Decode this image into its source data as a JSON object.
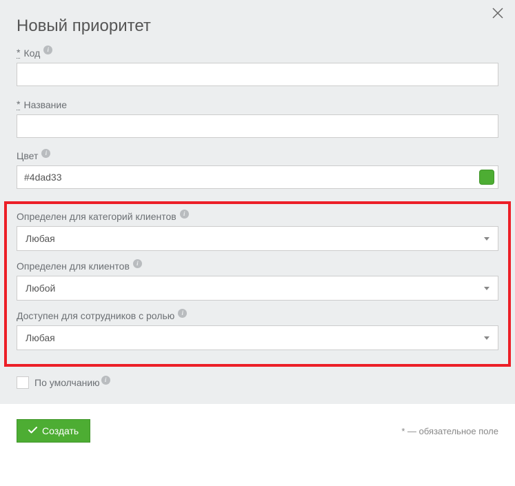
{
  "modal": {
    "title": "Новый приоритет"
  },
  "fields": {
    "code": {
      "label": "Код",
      "value": ""
    },
    "name": {
      "label": "Название",
      "value": ""
    },
    "color": {
      "label": "Цвет",
      "value": "#4dad33",
      "swatch": "#4dad33"
    },
    "client_categories": {
      "label": "Определен для категорий клиентов",
      "value": "Любая"
    },
    "clients": {
      "label": "Определен для клиентов",
      "value": "Любой"
    },
    "roles": {
      "label": "Доступен для сотрудников с ролью",
      "value": "Любая"
    },
    "default": {
      "label": "По умолчанию",
      "checked": false
    }
  },
  "footer": {
    "create": "Создать",
    "required_note": "* — обязательное поле"
  },
  "required_star": "*"
}
